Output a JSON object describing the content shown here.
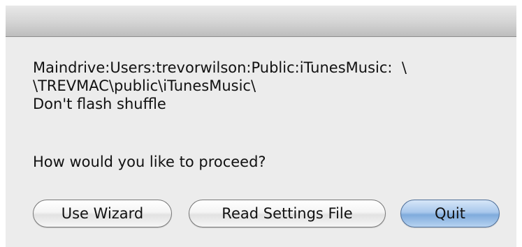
{
  "dialog": {
    "message_lines": [
      "Maindrive:Users:trevorwilson:Public:iTunesMusic:  \\",
      "\\TREVMAC\\public\\iTunesMusic\\",
      "Don't flash shuffle"
    ],
    "prompt": "How would you like to proceed?"
  },
  "buttons": {
    "use_wizard": "Use Wizard",
    "read_settings": "Read Settings File",
    "quit": "Quit"
  },
  "colors": {
    "window_background": "#ececec",
    "default_button": "#a9c8ec"
  }
}
